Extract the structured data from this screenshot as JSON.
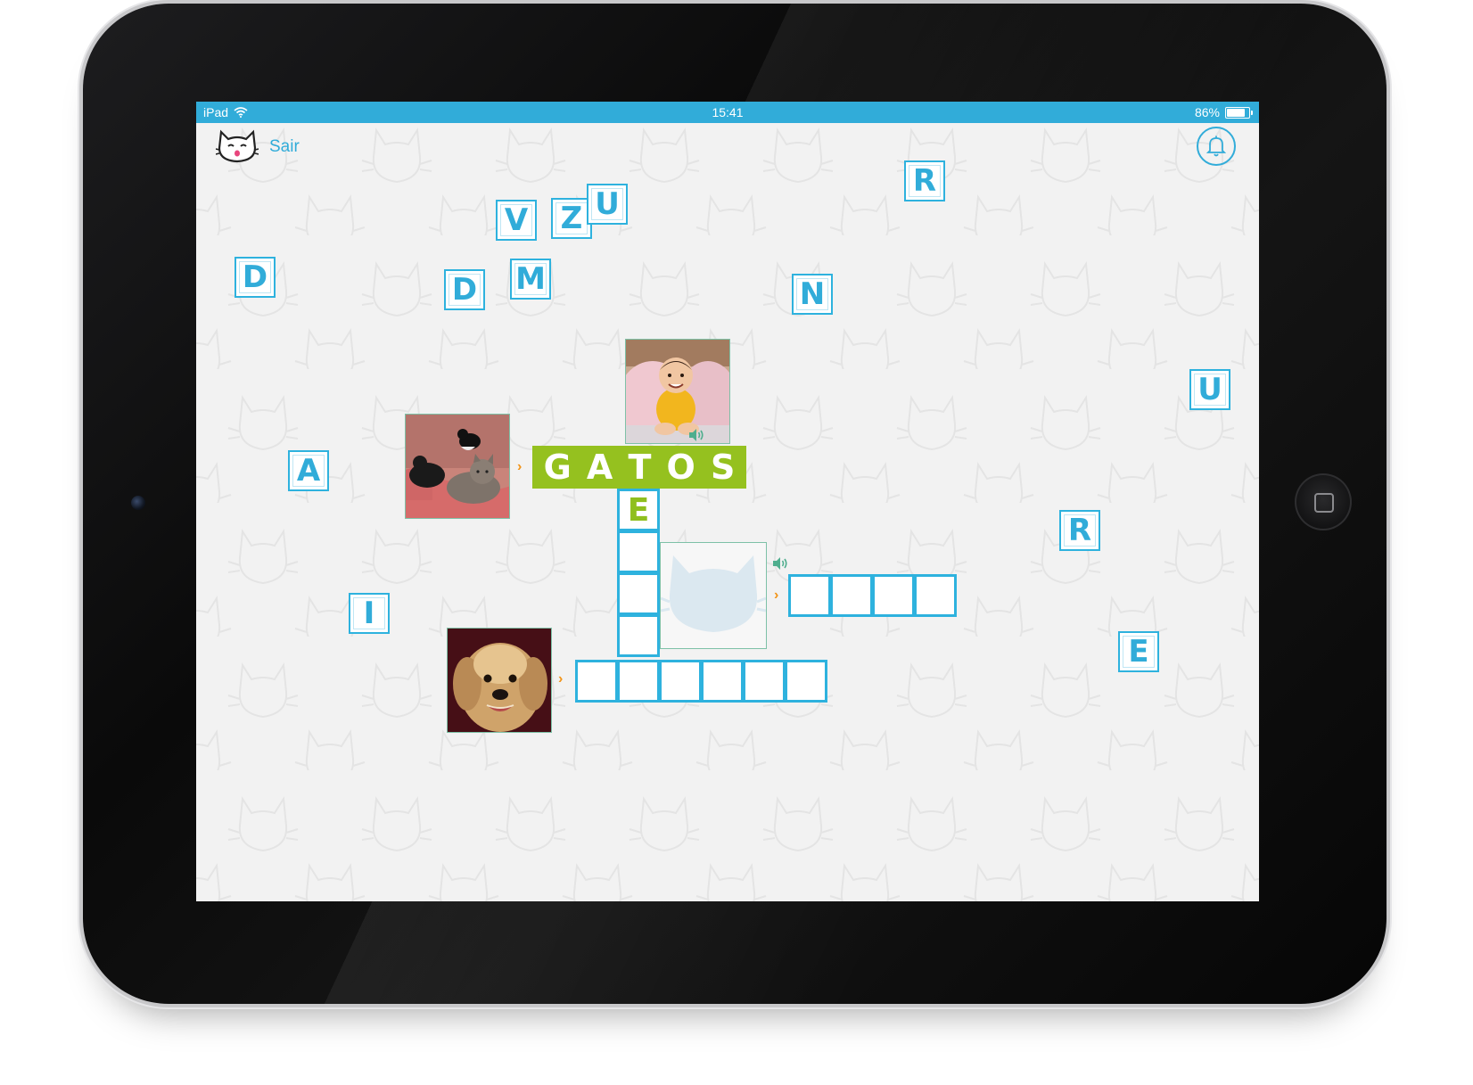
{
  "status_bar": {
    "device": "iPad",
    "time": "15:41",
    "battery": "86%",
    "battery_level": 0.86,
    "color": "#31acd9"
  },
  "header": {
    "logo_icon": "cat-face-icon",
    "exit_label": "Sair",
    "bell_icon": "bell-icon"
  },
  "loose_letters": [
    "R",
    "V",
    "Z",
    "U",
    "D",
    "D",
    "M",
    "N",
    "U",
    "A",
    "R",
    "I",
    "E"
  ],
  "puzzle": {
    "solved_word": [
      "G",
      "A",
      "T",
      "O",
      "S"
    ],
    "vertical_known_letter": "E",
    "clues": {
      "baby_photo": "baby-photo",
      "cats_photo": "cats-photo",
      "dog_photo": "dog-photo",
      "hidden_clue_icon": "cat-silhouette-icon"
    }
  },
  "colors": {
    "accent_blue": "#2eb2de",
    "solved_green": "#95c11f",
    "letter_green": "#8fbf1e",
    "arrow_orange": "#f29418",
    "speaker_green": "#4fae8e"
  }
}
